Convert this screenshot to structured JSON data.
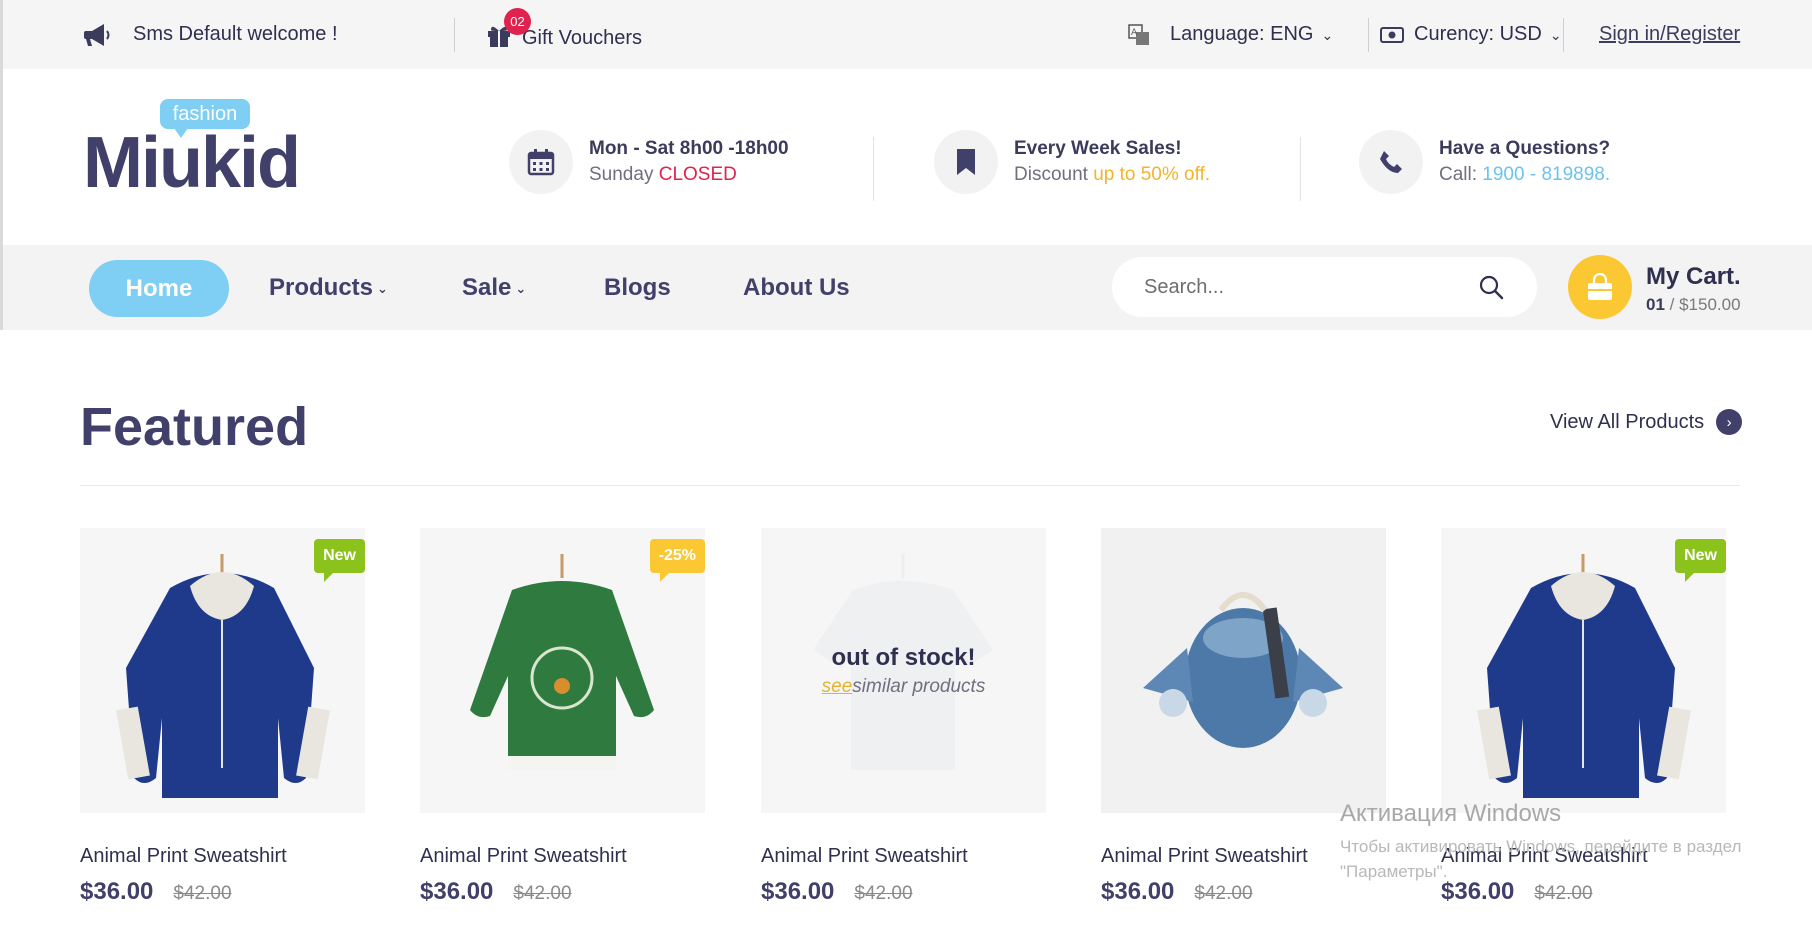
{
  "topbar": {
    "announcement": "Sms Default welcome !",
    "vouchers_label": "Gift Vouchers",
    "vouchers_count": "02",
    "language_label": "Language: ENG",
    "currency_label": "Curency: USD",
    "signin_label": "Sign in/Register"
  },
  "header": {
    "logo_main": "Miukid",
    "logo_tag": "fashion",
    "hours": {
      "line1": "Mon - Sat 8h00 -18h00",
      "line2_prefix": "Sunday ",
      "line2_highlight": "CLOSED"
    },
    "sales": {
      "line1": "Every Week Sales!",
      "line2_prefix": "Discount ",
      "line2_highlight": "up to 50% off."
    },
    "contact": {
      "line1": "Have a Questions?",
      "line2_prefix": "Call: ",
      "line2_highlight": "1900 - 819898."
    }
  },
  "nav": {
    "items": [
      "Home",
      "Products",
      "Sale",
      "Blogs",
      "About Us"
    ],
    "search_placeholder": "Search...",
    "cart_title": "My Cart.",
    "cart_count": "01",
    "cart_total": "/ $150.00"
  },
  "featured": {
    "title": "Featured",
    "view_all": "View All Products",
    "out_of_stock": {
      "line1": "out of stock!",
      "see": "see",
      "rest": "similar products"
    },
    "products": [
      {
        "name": "Animal Print Sweatshirt",
        "price": "$36.00",
        "old_price": "$42.00",
        "label": "New"
      },
      {
        "name": "Animal Print Sweatshirt",
        "price": "$36.00",
        "old_price": "$42.00",
        "label": "-25%"
      },
      {
        "name": "Animal Print Sweatshirt",
        "price": "$36.00",
        "old_price": "$42.00",
        "label": ""
      },
      {
        "name": "Animal Print Sweatshirt",
        "price": "$36.00",
        "old_price": "$42.00",
        "label": ""
      },
      {
        "name": "Animal Print Sweatshirt",
        "price": "$36.00",
        "old_price": "$42.00",
        "label": "New"
      }
    ]
  },
  "watermark": {
    "line1": "Активация Windows",
    "line2": "Чтобы активировать Windows, перейдите в раздел",
    "line3": "\"Параметры\"."
  },
  "colors": {
    "accent_blue": "#7fcef4",
    "accent_yellow": "#fbc833",
    "danger_red": "#e0234e",
    "new_green": "#8bc21c",
    "primary_text": "#41406a"
  }
}
